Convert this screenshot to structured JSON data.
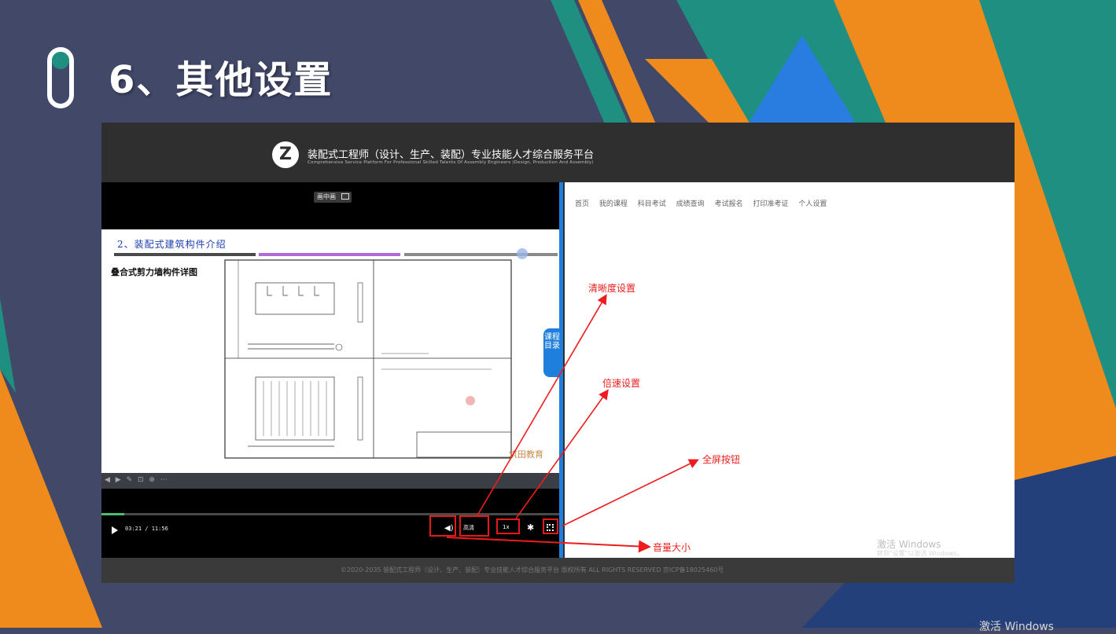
{
  "slide": {
    "title": "6、其他设置"
  },
  "screenshot": {
    "header": {
      "logo_letter": "Z",
      "title": "装配式工程师（设计、生产、装配）专业技能人才综合服务平台",
      "subtitle": "Comprehensive Service Platform For Professional Skilled Talents Of Assembly Engineers (Design, Production And Assembly)"
    },
    "player": {
      "pip_label": "画中画",
      "doc_heading": "2、装配式建筑构件介绍",
      "doc_subtitle": "叠合式剪力墙构件详图",
      "watermark": "筑田教育",
      "tool_icons": "◀ ▶ ✎ ⊡ ⊕ ⋯",
      "progress": 0.05,
      "time": "03:21 / 11:56",
      "volume_icon": "◀)",
      "quality_label": "高清",
      "speed_label": "1x",
      "gear_icon": "✱"
    },
    "catalog_tab_label": "课程目录",
    "nav": [
      "首页",
      "我的课程",
      "科目考试",
      "成绩查询",
      "考试报名",
      "打印准考证",
      "个人设置"
    ],
    "windows_activate": {
      "title": "激活 Windows",
      "sub": "转到\"设置\"以激活 Windows。"
    },
    "footer": "©2020-2035 装配式工程师（设计、生产、装配）专业技能人才综合服务平台 版权所有 ALL RIGHTS RESERVED 京ICP备18025460号"
  },
  "annotations": {
    "clarity": "清晰度设置",
    "speed": "倍速设置",
    "fullscreen": "全屏按钮",
    "volume": "音量大小"
  },
  "corner_text": "激活 Windows",
  "colors": {
    "background": "#424868",
    "teal": "#1f8f82",
    "orange": "#ef8a1c",
    "blue": "#1f7fdc",
    "annotation_red": "#ee1c1c"
  }
}
